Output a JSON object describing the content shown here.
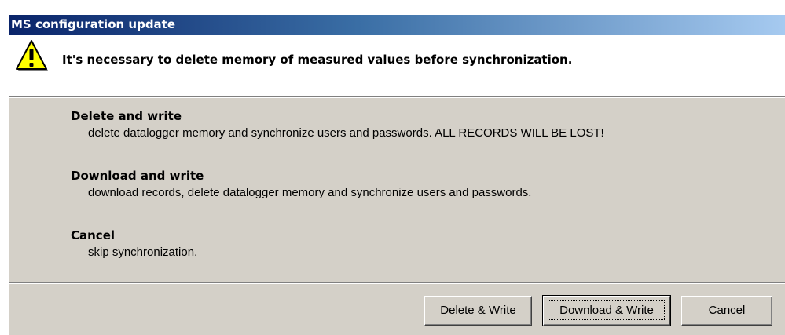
{
  "window": {
    "title": "MS configuration update"
  },
  "header": {
    "icon": "warning-icon",
    "message": "It's necessary to delete memory of measured values before synchronization."
  },
  "options": [
    {
      "title": "Delete and write",
      "description": "delete datalogger memory and synchronize users and passwords. ALL RECORDS WILL BE LOST!"
    },
    {
      "title": "Download and write",
      "description": "download records, delete datalogger memory and synchronize users and passwords."
    },
    {
      "title": "Cancel",
      "description": "skip synchronization."
    }
  ],
  "buttons": {
    "delete_write": "Delete & Write",
    "download_write": "Download & Write",
    "cancel": "Cancel"
  },
  "colors": {
    "titlebar_start": "#0a246a",
    "titlebar_end": "#a6caf0",
    "dialog_face": "#d4d0c8",
    "header_background": "#ffffff",
    "warning_yellow": "#ffff00"
  }
}
